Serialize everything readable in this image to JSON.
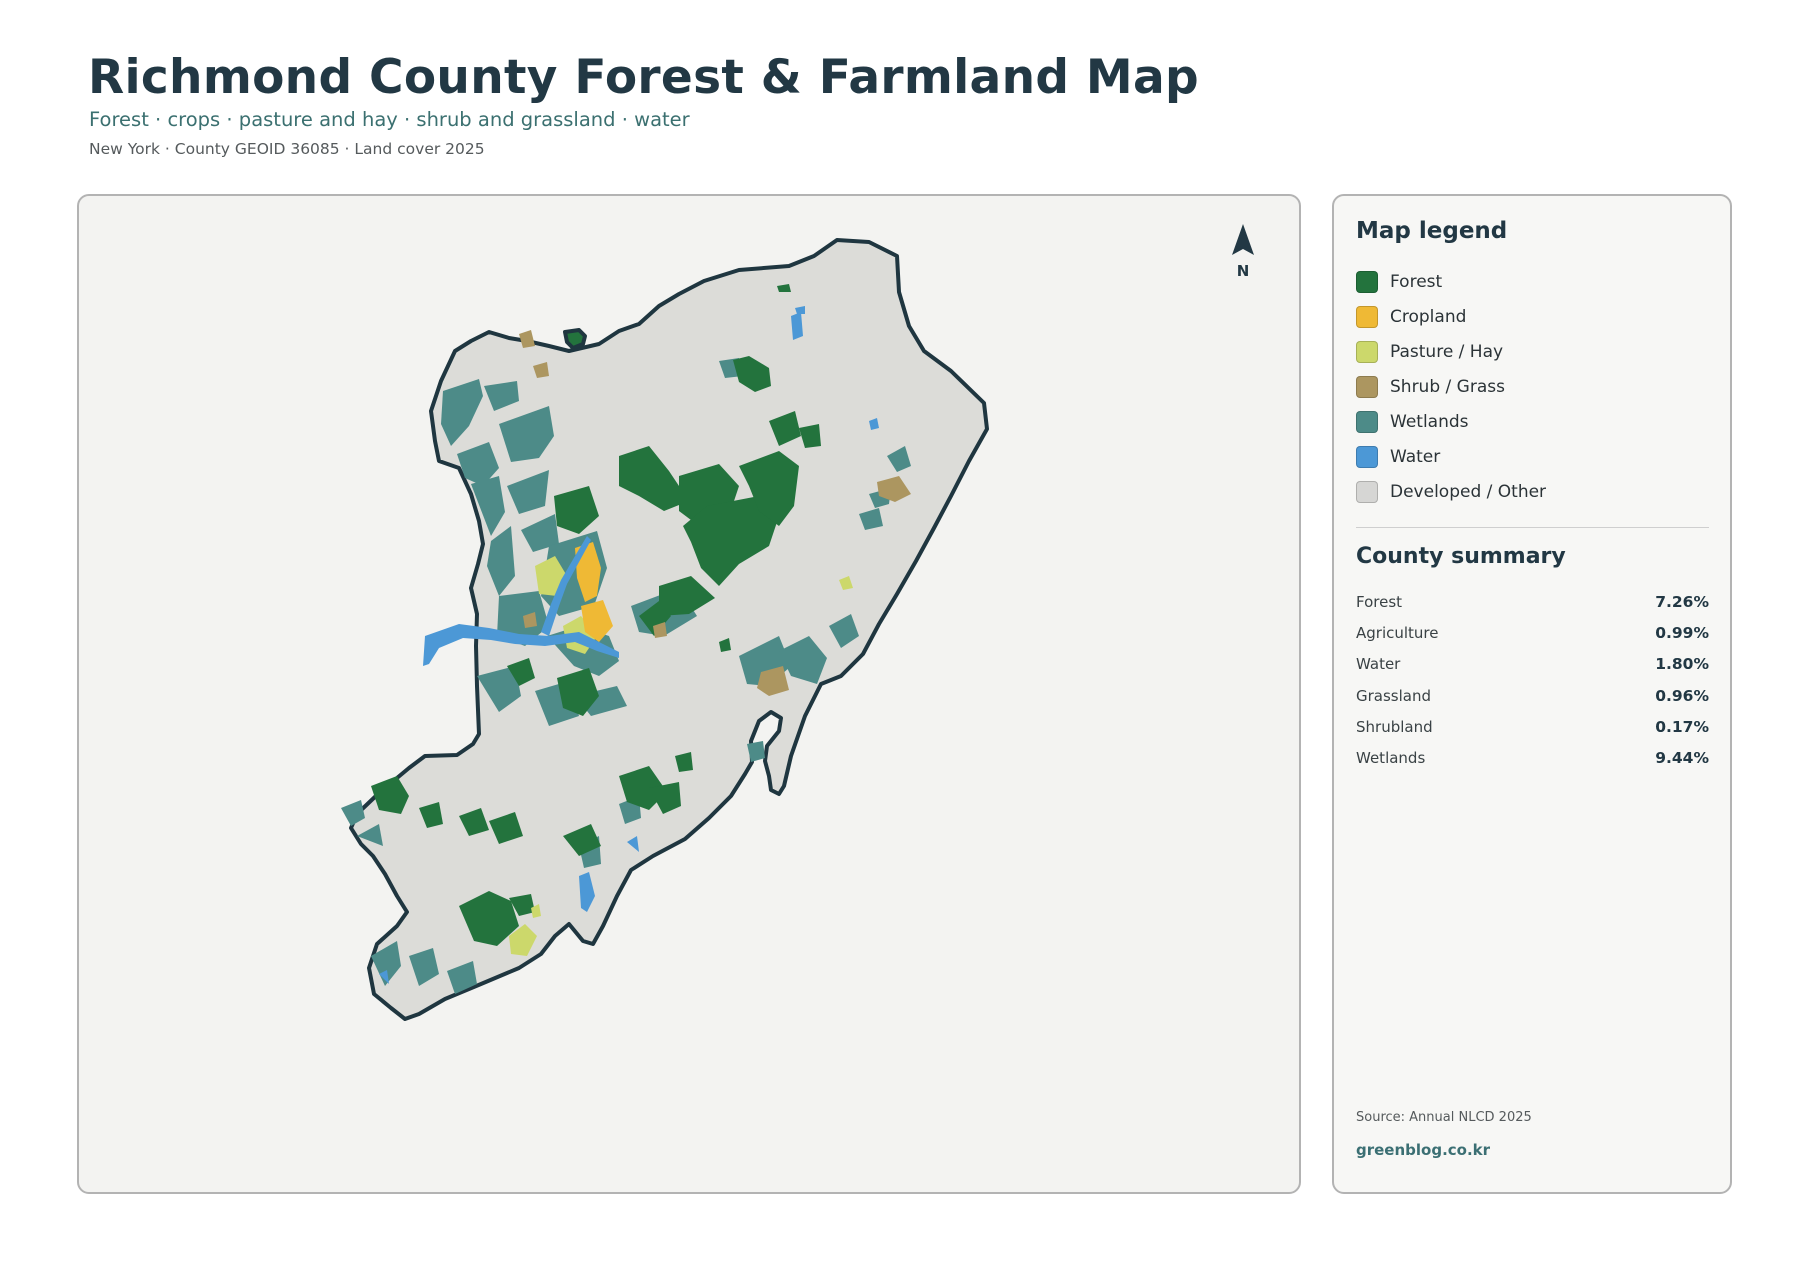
{
  "header": {
    "title": "Richmond County Forest & Farmland Map",
    "subtitle": "Forest · crops · pasture and hay · shrub and grassland · water",
    "meta": "New York · County GEOID 36085 · Land cover 2025"
  },
  "map": {
    "north_label": "N",
    "north_icon": "north-arrow-icon",
    "colors": {
      "outline": "#1f3640",
      "developed": "#dcdcd8",
      "forest": "#23733d",
      "cropland": "#efb935",
      "pasture": "#ccd86b",
      "shrub": "#ac9660",
      "wetlands": "#4d8b88",
      "water": "#4c98d6"
    }
  },
  "legend": {
    "title": "Map legend",
    "items": [
      {
        "label": "Forest",
        "color": "#23733d"
      },
      {
        "label": "Cropland",
        "color": "#efb935"
      },
      {
        "label": "Pasture / Hay",
        "color": "#ccd86b"
      },
      {
        "label": "Shrub / Grass",
        "color": "#ac9660"
      },
      {
        "label": "Wetlands",
        "color": "#4d8b88"
      },
      {
        "label": "Water",
        "color": "#4c98d6"
      },
      {
        "label": "Developed / Other",
        "color": "#d6d6d4"
      }
    ]
  },
  "summary": {
    "title": "County summary",
    "rows": [
      {
        "label": "Forest",
        "value": "7.26%"
      },
      {
        "label": "Agriculture",
        "value": "0.99%"
      },
      {
        "label": "Water",
        "value": "1.80%"
      },
      {
        "label": "Grassland",
        "value": "0.96%"
      },
      {
        "label": "Shrubland",
        "value": "0.17%"
      },
      {
        "label": "Wetlands",
        "value": "9.44%"
      }
    ]
  },
  "footer": {
    "source": "Source: Annual NLCD 2025",
    "site": "greenblog.co.kr"
  }
}
